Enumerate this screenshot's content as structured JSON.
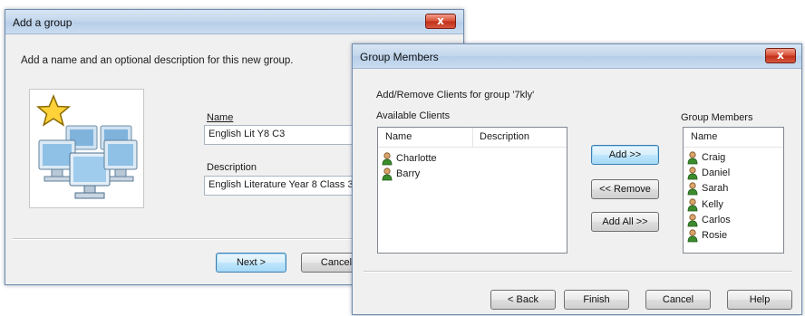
{
  "add_group": {
    "title": "Add a group",
    "close_label": "x",
    "instructions": "Add a name and an optional description for this new group.",
    "name_label": "Name",
    "name_value": "English Lit Y8 C3",
    "description_label": "Description",
    "description_value": "English Literature Year 8 Class 3",
    "next_label": "Next >",
    "cancel_label": "Cancel",
    "icons": [
      "star-icon",
      "computer-group-icon"
    ]
  },
  "group_members": {
    "title": "Group Members",
    "close_label": "x",
    "header_text": "Add/Remove Clients for group '7kly'",
    "available_label": "Available Clients",
    "available_columns": [
      "Name",
      "Description"
    ],
    "available_clients": [
      "Charlotte",
      "Barry"
    ],
    "members_label": "Group Members",
    "members_column": "Name",
    "members": [
      "Craig",
      "Daniel",
      "Sarah",
      "Kelly",
      "Carlos",
      "Rosie"
    ],
    "add_label": "Add >>",
    "remove_label": "<< Remove",
    "add_all_label": "Add All >>",
    "back_label": "< Back",
    "finish_label": "Finish",
    "cancel_label": "Cancel",
    "help_label": "Help",
    "icons": [
      "person-icon"
    ]
  },
  "colors": {
    "titlebar": "#c2d6ec",
    "close_button": "#c1301a",
    "window_body": "#f0f0f0",
    "person_head": "#d9a46a",
    "person_body": "#3c8c2e"
  }
}
